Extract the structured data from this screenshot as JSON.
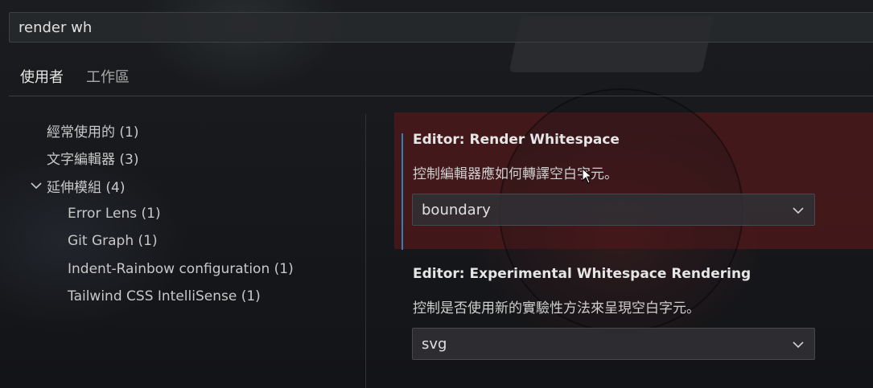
{
  "search": {
    "value": "render wh"
  },
  "tabs": [
    {
      "label": "使用者",
      "active": true
    },
    {
      "label": "工作區",
      "active": false
    }
  ],
  "tree": {
    "items": [
      {
        "label": "經常使用的 (1)",
        "level": 1
      },
      {
        "label": "文字編輯器 (3)",
        "level": 1
      },
      {
        "label": "延伸模組 (4)",
        "level": 1,
        "expanded": true,
        "icon": "chevron-down-icon"
      },
      {
        "label": "Error Lens (1)",
        "level": 2
      },
      {
        "label": "Git Graph (1)",
        "level": 2
      },
      {
        "label": "Indent-Rainbow configuration (1)",
        "level": 2
      },
      {
        "label": "Tailwind CSS IntelliSense (1)",
        "level": 2
      }
    ]
  },
  "settings": [
    {
      "title": "Editor: Render Whitespace",
      "description": "控制編輯器應如何轉譯空白字元。",
      "value": "boundary",
      "focused": true
    },
    {
      "title": "Editor: Experimental Whitespace Rendering",
      "description": "控制是否使用新的實驗性方法來呈現空白字元。",
      "value": "svg",
      "focused": false
    }
  ],
  "colors": {
    "focus_bar": "#2f7fb8",
    "background": "#15171a",
    "highlight_band": "#781919"
  }
}
